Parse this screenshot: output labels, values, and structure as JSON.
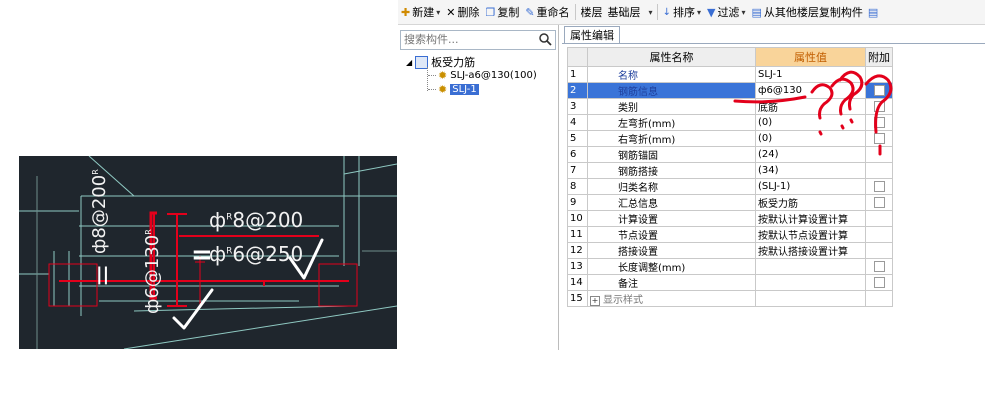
{
  "toolbar": {
    "new_label": "新建",
    "delete_label": "删除",
    "copy_label": "复制",
    "rename_label": "重命名",
    "floor_label": "楼层",
    "floor_value": "基础层",
    "sort_label": "排序",
    "filter_label": "过滤",
    "copy_from_floor_label": "从其他楼层复制构件"
  },
  "search": {
    "placeholder": "搜索构件..."
  },
  "tree": {
    "root": "板受力筋",
    "children": [
      "SLJ-a6@130(100)",
      "SLJ-1"
    ],
    "selected_index": 1
  },
  "property_panel": {
    "tab": "属性编辑",
    "headers": {
      "name": "属性名称",
      "value": "属性值",
      "extra": "附加"
    },
    "rows": [
      {
        "num": "1",
        "name": "名称",
        "value": "SLJ-1",
        "checkbox": false,
        "blue": true
      },
      {
        "num": "2",
        "name": "钢筋信息",
        "value": "ф6@130",
        "checkbox": true,
        "blue": true,
        "selected": true
      },
      {
        "num": "3",
        "name": "类别",
        "value": "底筋",
        "checkbox": true
      },
      {
        "num": "4",
        "name": "左弯折(mm)",
        "value": "(0)",
        "checkbox": true
      },
      {
        "num": "5",
        "name": "右弯折(mm)",
        "value": "(0)",
        "checkbox": true
      },
      {
        "num": "6",
        "name": "钢筋锚固",
        "value": "(24)",
        "checkbox": false
      },
      {
        "num": "7",
        "name": "钢筋搭接",
        "value": "(34)",
        "checkbox": false
      },
      {
        "num": "8",
        "name": "归类名称",
        "value": "(SLJ-1)",
        "checkbox": true
      },
      {
        "num": "9",
        "name": "汇总信息",
        "value": "板受力筋",
        "checkbox": true
      },
      {
        "num": "10",
        "name": "计算设置",
        "value": "按默认计算设置计算",
        "checkbox": false
      },
      {
        "num": "11",
        "name": "节点设置",
        "value": "按默认节点设置计算",
        "checkbox": false
      },
      {
        "num": "12",
        "name": "搭接设置",
        "value": "按默认搭接设置计算",
        "checkbox": false
      },
      {
        "num": "13",
        "name": "长度调整(mm)",
        "value": "",
        "checkbox": true
      },
      {
        "num": "14",
        "name": "备注",
        "value": "",
        "checkbox": true
      },
      {
        "num": "15",
        "name": "显示样式",
        "value": "",
        "checkbox": false,
        "group": true
      }
    ]
  },
  "cad": {
    "label_top": "ф",
    "label_top_sup": "R",
    "label_top_rest": "8@200",
    "label_mid": "ф",
    "label_mid_sup": "R",
    "label_mid_rest": "6@250",
    "label_v1": "ф8@200",
    "label_v1_sup": "R",
    "label_v2": "ф6@130",
    "label_v2_sup": "R"
  },
  "annotations": {
    "mark_equal": "=",
    "mark_double": "||",
    "mark_question": "???"
  },
  "colors": {
    "selection": "#3a74d8",
    "header_value_bg": "#f9d49a",
    "annotation_red": "#e3001b",
    "cad_bg": "#1f262d"
  }
}
